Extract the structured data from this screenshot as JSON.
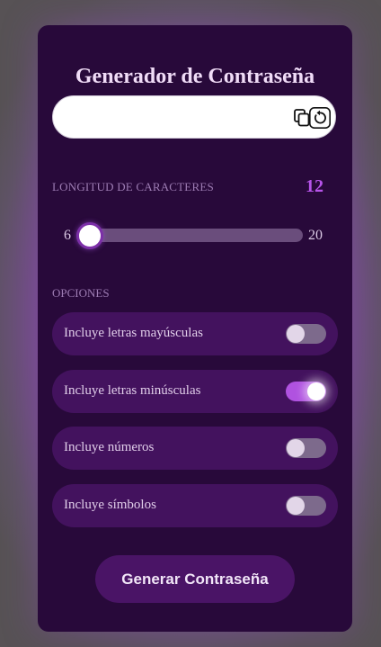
{
  "app": {
    "title": "Generador de Contraseña"
  },
  "password": {
    "value": "",
    "placeholder": ""
  },
  "icons": {
    "copy": "copy-icon",
    "refresh": "refresh-icon"
  },
  "length": {
    "label": "LONGITUD DE CARACTERES",
    "value": "12",
    "min": "6",
    "max": "20",
    "slider_fraction": 0.0
  },
  "options": {
    "label": "OPCIONES",
    "items": [
      {
        "label": "Incluye letras mayúsculas",
        "enabled": false
      },
      {
        "label": "Incluye letras minúsculas",
        "enabled": true
      },
      {
        "label": "Incluye números",
        "enabled": false
      },
      {
        "label": "Incluye símbolos",
        "enabled": false
      }
    ]
  },
  "generate_button": {
    "label": "Generar Contraseña"
  },
  "colors": {
    "card_bg": "#28093a",
    "accent": "#b754ea",
    "option_bg": "#43125e",
    "toggle_on": "#b052e0",
    "toggle_off": "#7d6a8c"
  }
}
